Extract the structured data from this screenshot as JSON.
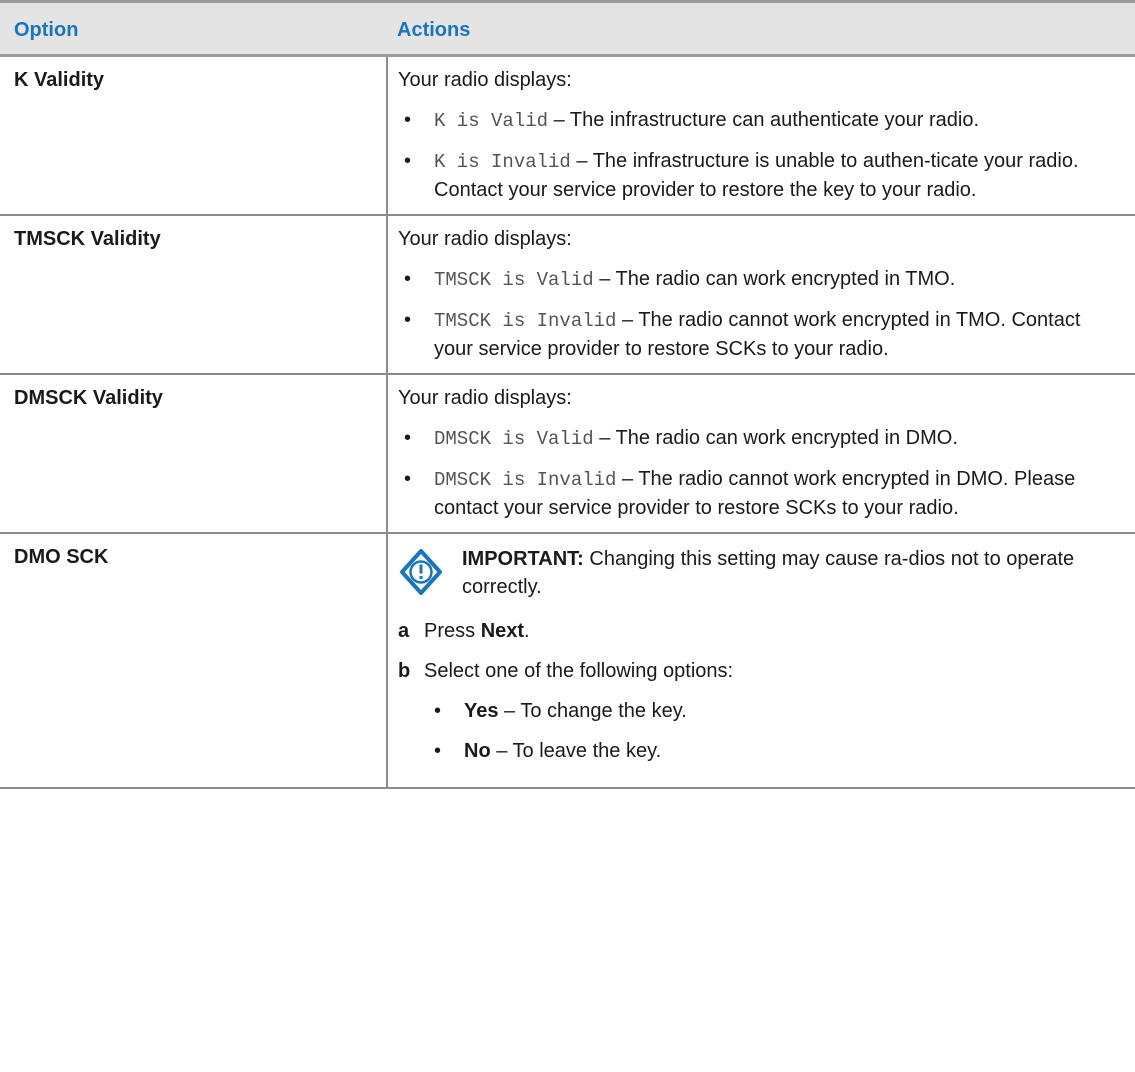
{
  "header": {
    "option": "Option",
    "actions": "Actions"
  },
  "rows": [
    {
      "option": "K Validity",
      "intro": "Your radio displays:",
      "items": [
        {
          "code": "K is Valid",
          "text": " – The infrastructure can authenticate your radio."
        },
        {
          "code": "K is Invalid",
          "text": " – The infrastructure is unable to authen-ticate your radio. Contact your service provider to restore the key to your radio."
        }
      ]
    },
    {
      "option": "TMSCK Validity",
      "intro": "Your radio displays:",
      "items": [
        {
          "code": "TMSCK is Valid",
          "text": " – The radio can work encrypted in TMO."
        },
        {
          "code": "TMSCK is Invalid",
          "text": " – The radio cannot work encrypted in TMO. Contact your service provider to restore SCKs to your radio."
        }
      ]
    },
    {
      "option": "DMSCK Validity",
      "intro": "Your radio displays:",
      "items": [
        {
          "code": "DMSCK is Valid",
          "text": " – The radio can work encrypted in DMO."
        },
        {
          "code": "DMSCK is Invalid",
          "text": " – The radio cannot work encrypted in DMO. Please contact your service provider to restore SCKs to your radio."
        }
      ]
    },
    {
      "option": "DMO SCK",
      "important": {
        "label": "IMPORTANT:",
        "text": " Changing this setting may cause ra-dios not to operate correctly."
      },
      "steps": [
        {
          "letter": "a",
          "pre": "Press ",
          "bold": "Next",
          "post": "."
        },
        {
          "letter": "b",
          "text": "Select one of the following options:",
          "options": [
            {
              "bold": "Yes",
              "text": " – To change the key."
            },
            {
              "bold": "No",
              "text": " – To leave the key."
            }
          ]
        }
      ]
    }
  ],
  "bullet": "•",
  "colors": {
    "header_text": "#1976bd",
    "header_bg": "#e4e4e4",
    "icon": "#1976bd"
  }
}
